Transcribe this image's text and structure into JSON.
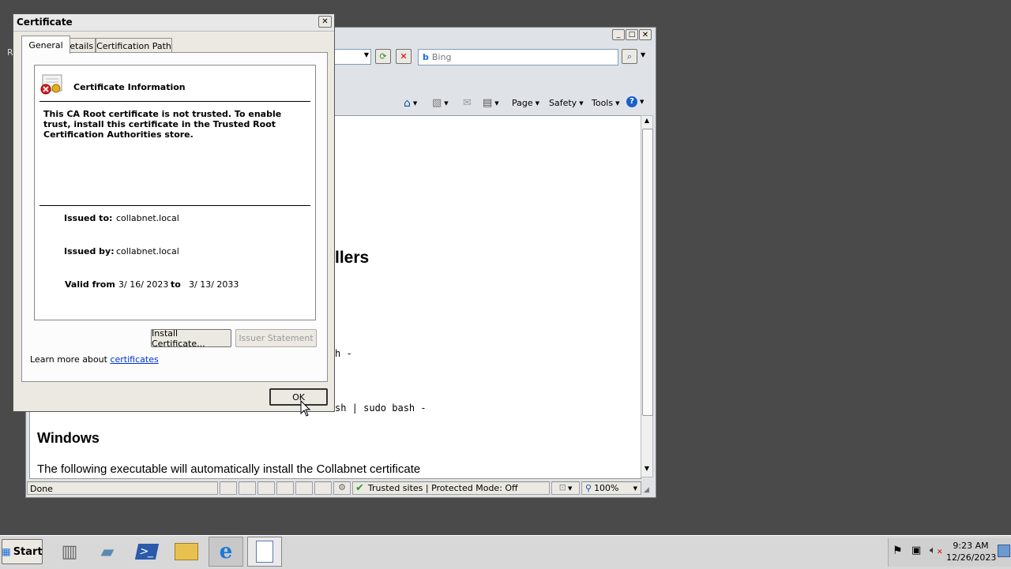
{
  "ie": {
    "search_placeholder": "Bing",
    "toolbar": {
      "page": "Page",
      "safety": "Safety",
      "tools": "Tools"
    },
    "content": {
      "heading_fragment": "llers",
      "line1": "h -",
      "line2": "sh | sudo bash -",
      "windows_heading": "Windows",
      "windows_text": "The following executable will automatically install the Collabnet certificate"
    },
    "status": {
      "done": "Done",
      "zone": "Trusted sites | Protected Mode: Off",
      "zoom": "100%"
    }
  },
  "desktop": {
    "partial_label": "R"
  },
  "dialog": {
    "title": "Certificate",
    "tabs": [
      "General",
      "Details",
      "Certification Path"
    ],
    "info_title": "Certificate Information",
    "warning": "This CA Root certificate is not trusted. To enable trust, install this certificate in the Trusted Root Certification Authorities store.",
    "issued_to_label": "Issued to:",
    "issued_to": "collabnet.local",
    "issued_by_label": "Issued by:",
    "issued_by": "collabnet.local",
    "valid_from_label": "Valid from",
    "valid_from": "3/ 16/ 2023",
    "to_label": "to",
    "valid_to": "3/ 13/ 2033",
    "install_button": "Install Certificate...",
    "issuer_button": "Issuer Statement",
    "learn_more": "Learn more about",
    "learn_link": "certificates",
    "ok": "OK"
  },
  "taskbar": {
    "start": "Start",
    "time": "9:23 AM",
    "date": "12/26/2023"
  }
}
